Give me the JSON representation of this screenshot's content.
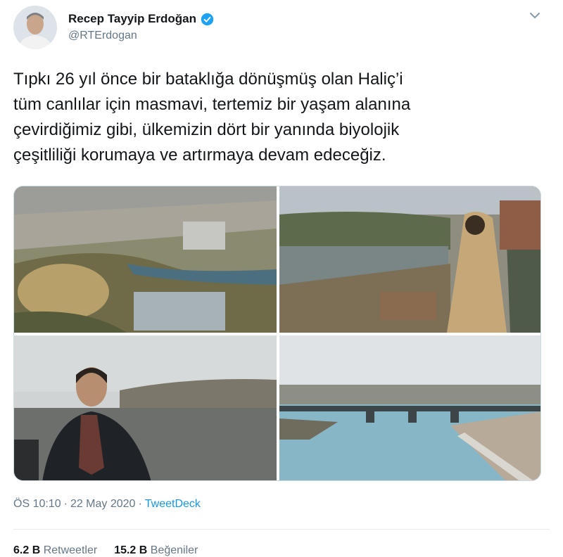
{
  "author": {
    "name": "Recep Tayyip Erdoğan",
    "handle": "@RTErdogan"
  },
  "tweet": {
    "lines": [
      "Tıpkı 26 yıl önce bir bataklığa dönüşmüş olan Haliç’i",
      "tüm canlılar için masmavi, tertemiz bir yaşam alanına",
      "çevirdiğimiz gibi, ülkemizin dört bir yanında biyolojik",
      "çeşitliliği korumaya ve artırmaya devam edeceğiz."
    ]
  },
  "meta": {
    "time": "ÖS 10:10",
    "date": "22 May 2020",
    "app": "TweetDeck"
  },
  "stats": {
    "retweets_count": "6.2 B",
    "retweets_label": "Retweetler",
    "likes_count": "15.2 B",
    "likes_label": "Beğeniler"
  },
  "colors": {
    "accent": "#1b95e0",
    "verified": "#1da1f2",
    "muted": "#657786"
  }
}
